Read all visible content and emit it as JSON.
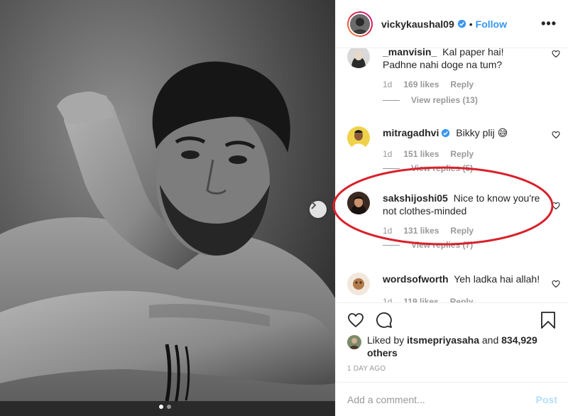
{
  "post": {
    "author": "vickykaushal09",
    "separator": "•",
    "follow_label": "Follow",
    "more_label": "•••"
  },
  "comments": [
    {
      "user": "_manvisin_",
      "text": "Kal paper hai! Padhne nahi doge na tum?",
      "age": "1d",
      "likes": "169 likes",
      "reply": "Reply",
      "replies": "View replies (13)"
    },
    {
      "user": "mitragadhvi",
      "verified": true,
      "text": "Bikky plij 😅",
      "age": "1d",
      "likes": "151 likes",
      "reply": "Reply",
      "replies": "View replies (5)"
    },
    {
      "user": "sakshijoshi05",
      "text": "Nice to know you're not clothes-minded",
      "age": "1d",
      "likes": "131 likes",
      "reply": "Reply",
      "replies": "View replies (7)"
    },
    {
      "user": "wordsofworth",
      "text": "Yeh ladka hai allah!",
      "age": "1d",
      "likes": "119 likes",
      "reply": "Reply"
    }
  ],
  "likes": {
    "prefix": "Liked by",
    "user": "itsmepriyasaha",
    "and": "and",
    "count": "834,929 others"
  },
  "timestamp": "1 DAY AGO",
  "add_comment": {
    "placeholder": "Add a comment...",
    "post_label": "Post"
  },
  "colors": {
    "link": "#3897f0",
    "verified": "#3897f0",
    "highlight": "#d9212b",
    "post_disabled": "#b2dffc"
  },
  "carousel": {
    "current": 1,
    "total": 2
  }
}
